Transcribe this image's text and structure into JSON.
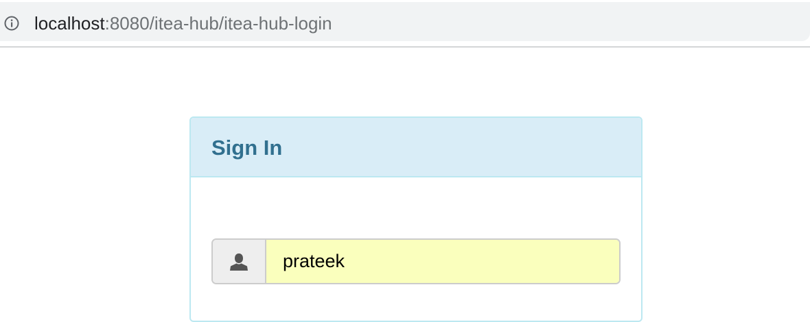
{
  "browser": {
    "url_host": "localhost",
    "url_path": ":8080/itea-hub/itea-hub-login",
    "info_icon": "info-circle-icon"
  },
  "login_panel": {
    "title": "Sign In",
    "username": {
      "icon": "user-icon",
      "value": "prateek"
    }
  },
  "colors": {
    "panel_heading_bg": "#d9edf7",
    "panel_border": "#bce8f1",
    "panel_title": "#31708f",
    "autofill_bg": "#faffbd",
    "addon_bg": "#eeeeee"
  }
}
